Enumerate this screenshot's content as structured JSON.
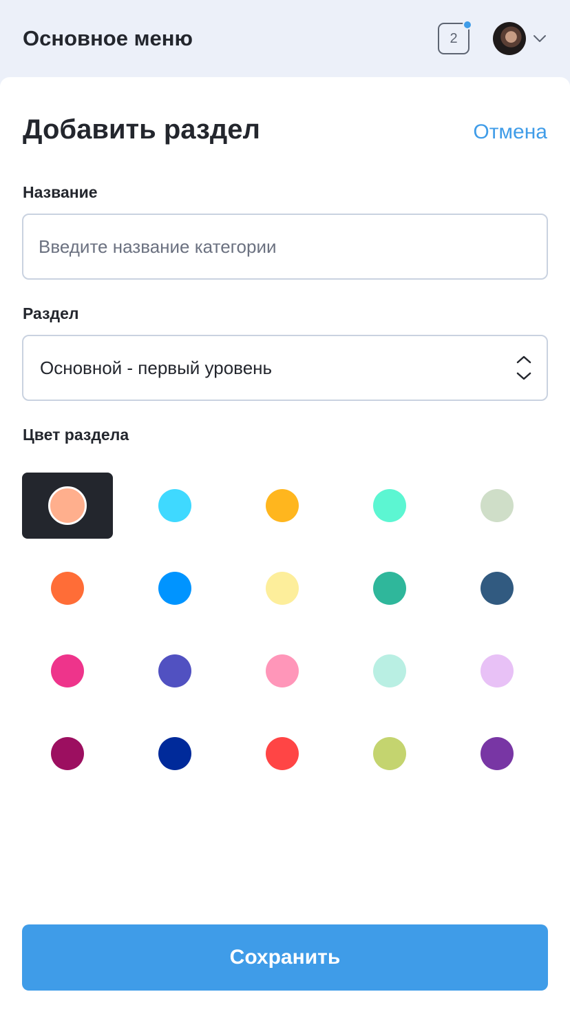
{
  "header": {
    "title": "Основное меню",
    "notifications_count": "2"
  },
  "form": {
    "title": "Добавить раздел",
    "cancel_label": "Отмена",
    "name_label": "Название",
    "name_placeholder": "Введите название категории",
    "name_value": "",
    "section_label": "Раздел",
    "section_value": "Основной - первый уровень",
    "color_label": "Цвет раздела",
    "save_label": "Сохранить"
  },
  "colors": {
    "selected_index": 0,
    "swatches": [
      "#ffaf8d",
      "#3fd9ff",
      "#ffb61e",
      "#5cf6d2",
      "#cfdec8",
      "#ff6d37",
      "#0094ff",
      "#fdee9b",
      "#2fb79b",
      "#315a80",
      "#ee348b",
      "#5151c1",
      "#ff96b9",
      "#b9efe3",
      "#e8c1f6",
      "#9c0f60",
      "#002a9a",
      "#ff4545",
      "#c4d46f",
      "#7836a4"
    ]
  },
  "icons": {
    "notification": "notification-badge-icon",
    "avatar": "user-avatar",
    "dropdown": "chevron-down-icon",
    "select": "up-down-chevrons-icon"
  }
}
